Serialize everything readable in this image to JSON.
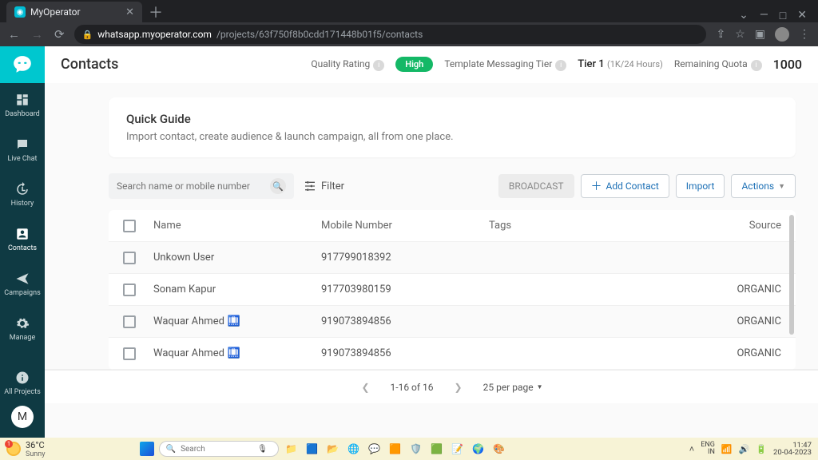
{
  "browser": {
    "tab_title": "MyOperator",
    "url_host": "whatsapp.myoperator.com",
    "url_path": "/projects/63f750f8b0cdd171448b01f5/contacts"
  },
  "sidebar": {
    "items": [
      {
        "label": "Dashboard"
      },
      {
        "label": "Live Chat"
      },
      {
        "label": "History"
      },
      {
        "label": "Contacts"
      },
      {
        "label": "Campaigns"
      },
      {
        "label": "Manage"
      },
      {
        "label": "All Projects"
      }
    ],
    "profile_initial": "M"
  },
  "header": {
    "title": "Contacts",
    "quality_label": "Quality Rating",
    "quality_value": "High",
    "template_label": "Template Messaging Tier",
    "tier_value": "Tier 1",
    "tier_detail": "(1K/24 Hours)",
    "remaining_label": "Remaining Quota",
    "remaining_value": "1000"
  },
  "guide": {
    "title": "Quick Guide",
    "text": "Import contact, create audience & launch campaign, all from one place."
  },
  "toolbar": {
    "search_placeholder": "Search name or mobile number",
    "filter_label": "Filter",
    "broadcast_label": "BROADCAST",
    "add_contact_label": "Add Contact",
    "import_label": "Import",
    "actions_label": "Actions"
  },
  "table": {
    "columns": {
      "name": "Name",
      "mobile": "Mobile Number",
      "tags": "Tags",
      "source": "Source"
    },
    "rows": [
      {
        "name": "Unkown User",
        "mobile": "917799018392",
        "tags": "",
        "source": ""
      },
      {
        "name": "Sonam Kapur",
        "mobile": "917703980159",
        "tags": "",
        "source": "ORGANIC"
      },
      {
        "name": "Waquar Ahmed",
        "emoji": "🛄",
        "mobile": "919073894856",
        "tags": "",
        "source": "ORGANIC"
      },
      {
        "name": "Waquar Ahmed",
        "emoji": "🛄",
        "mobile": "919073894856",
        "tags": "",
        "source": "ORGANIC"
      }
    ]
  },
  "pager": {
    "range": "1-16 of 16",
    "per_page": "25 per page"
  },
  "taskbar": {
    "temp": "36°C",
    "weather": "Sunny",
    "search_placeholder": "Search",
    "lang1": "ENG",
    "lang2": "IN",
    "time": "11:47",
    "date": "20-04-2023"
  }
}
